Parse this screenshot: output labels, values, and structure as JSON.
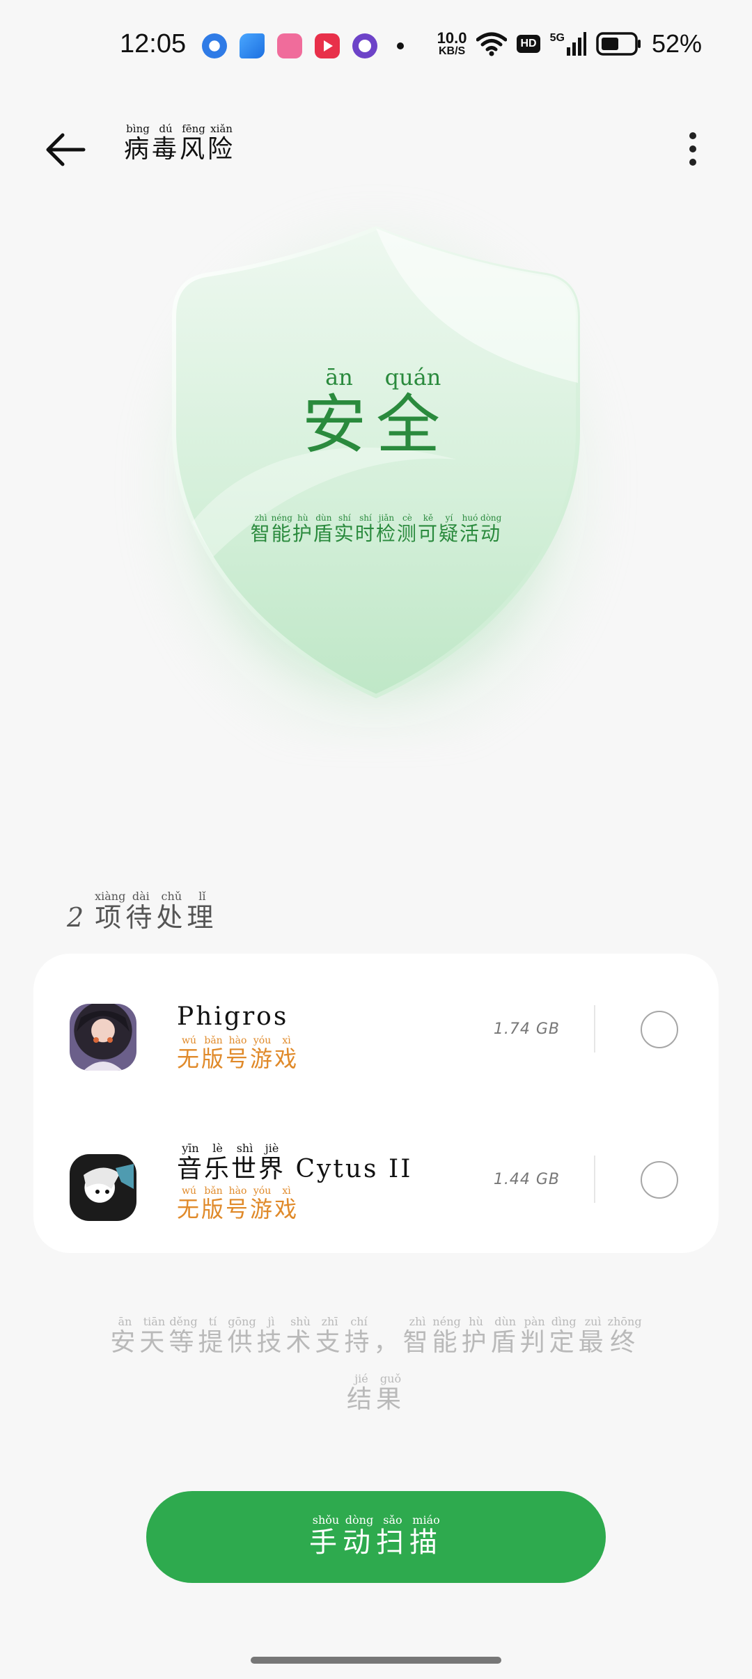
{
  "status_bar": {
    "time": "12:05",
    "net_speed_value": "10.0",
    "net_speed_unit": "KB/S",
    "hd_badge": "HD",
    "signal_label": "5G",
    "battery_percent": "52%",
    "app_icons": [
      "qq-browser-icon",
      "feishu-icon",
      "bilibili-icon",
      "youtube-icon",
      "purple-app-icon"
    ]
  },
  "header": {
    "title_chars": [
      {
        "char": "病",
        "pinyin": "bìng"
      },
      {
        "char": "毒",
        "pinyin": "dú"
      },
      {
        "char": "风",
        "pinyin": "fēng"
      },
      {
        "char": "险",
        "pinyin": "xiǎn"
      }
    ]
  },
  "shield": {
    "status_chars": [
      {
        "char": "安",
        "pinyin": "ān"
      },
      {
        "char": "全",
        "pinyin": "quán"
      }
    ],
    "subtitle_chars": [
      {
        "char": "智",
        "pinyin": "zhì"
      },
      {
        "char": "能",
        "pinyin": "néng"
      },
      {
        "char": "护",
        "pinyin": "hù"
      },
      {
        "char": "盾",
        "pinyin": "dùn"
      },
      {
        "char": "实",
        "pinyin": "shí"
      },
      {
        "char": "时",
        "pinyin": "shí"
      },
      {
        "char": "检",
        "pinyin": "jiǎn"
      },
      {
        "char": "测",
        "pinyin": "cè"
      },
      {
        "char": "可",
        "pinyin": "kě"
      },
      {
        "char": "疑",
        "pinyin": "yí"
      },
      {
        "char": "活",
        "pinyin": "huó"
      },
      {
        "char": "动",
        "pinyin": "dòng"
      }
    ]
  },
  "pending": {
    "count": "2",
    "label_chars": [
      {
        "char": "项",
        "pinyin": "xiàng"
      },
      {
        "char": "待",
        "pinyin": "dài"
      },
      {
        "char": "处",
        "pinyin": "chǔ"
      },
      {
        "char": "理",
        "pinyin": "lǐ"
      }
    ],
    "items": [
      {
        "name_plain": "Phigros",
        "name_chars": [],
        "tag_chars": [
          {
            "char": "无",
            "pinyin": "wú"
          },
          {
            "char": "版",
            "pinyin": "bǎn"
          },
          {
            "char": "号",
            "pinyin": "hào"
          },
          {
            "char": "游",
            "pinyin": "yóu"
          },
          {
            "char": "戏",
            "pinyin": "xì"
          }
        ],
        "size": "1.74 GB"
      },
      {
        "name_plain": "Cytus II",
        "name_chars": [
          {
            "char": "音",
            "pinyin": "yīn"
          },
          {
            "char": "乐",
            "pinyin": "lè"
          },
          {
            "char": "世",
            "pinyin": "shì"
          },
          {
            "char": "界",
            "pinyin": "jiè"
          }
        ],
        "tag_chars": [
          {
            "char": "无",
            "pinyin": "wú"
          },
          {
            "char": "版",
            "pinyin": "bǎn"
          },
          {
            "char": "号",
            "pinyin": "hào"
          },
          {
            "char": "游",
            "pinyin": "yóu"
          },
          {
            "char": "戏",
            "pinyin": "xì"
          }
        ],
        "size": "1.44 GB"
      }
    ]
  },
  "footer": {
    "note_chars": [
      {
        "char": "安",
        "pinyin": "ān"
      },
      {
        "char": "天",
        "pinyin": "tiān"
      },
      {
        "char": "等",
        "pinyin": "děng"
      },
      {
        "char": "提",
        "pinyin": "tí"
      },
      {
        "char": "供",
        "pinyin": "gōng"
      },
      {
        "char": "技",
        "pinyin": "jì"
      },
      {
        "char": "术",
        "pinyin": "shù"
      },
      {
        "char": "支",
        "pinyin": "zhī"
      },
      {
        "char": "持",
        "pinyin": "chí"
      },
      {
        "char": "，",
        "pinyin": ""
      },
      {
        "char": "智",
        "pinyin": "zhì"
      },
      {
        "char": "能",
        "pinyin": "néng"
      },
      {
        "char": "护",
        "pinyin": "hù"
      },
      {
        "char": "盾",
        "pinyin": "dùn"
      },
      {
        "char": "判",
        "pinyin": "pàn"
      },
      {
        "char": "定",
        "pinyin": "dìng"
      },
      {
        "char": "最",
        "pinyin": "zuì"
      },
      {
        "char": "终",
        "pinyin": "zhōng"
      },
      {
        "char": "结",
        "pinyin": "jié"
      },
      {
        "char": "果",
        "pinyin": "guǒ"
      }
    ]
  },
  "scan_button": {
    "label_chars": [
      {
        "char": "手",
        "pinyin": "shǒu"
      },
      {
        "char": "动",
        "pinyin": "dòng"
      },
      {
        "char": "扫",
        "pinyin": "sǎo"
      },
      {
        "char": "描",
        "pinyin": "miáo"
      }
    ]
  },
  "colors": {
    "accent_green": "#2eaa4e",
    "shield_text_green": "#2a8a3d",
    "tag_orange": "#e08a2a",
    "muted_gray": "#b9b9b9"
  }
}
